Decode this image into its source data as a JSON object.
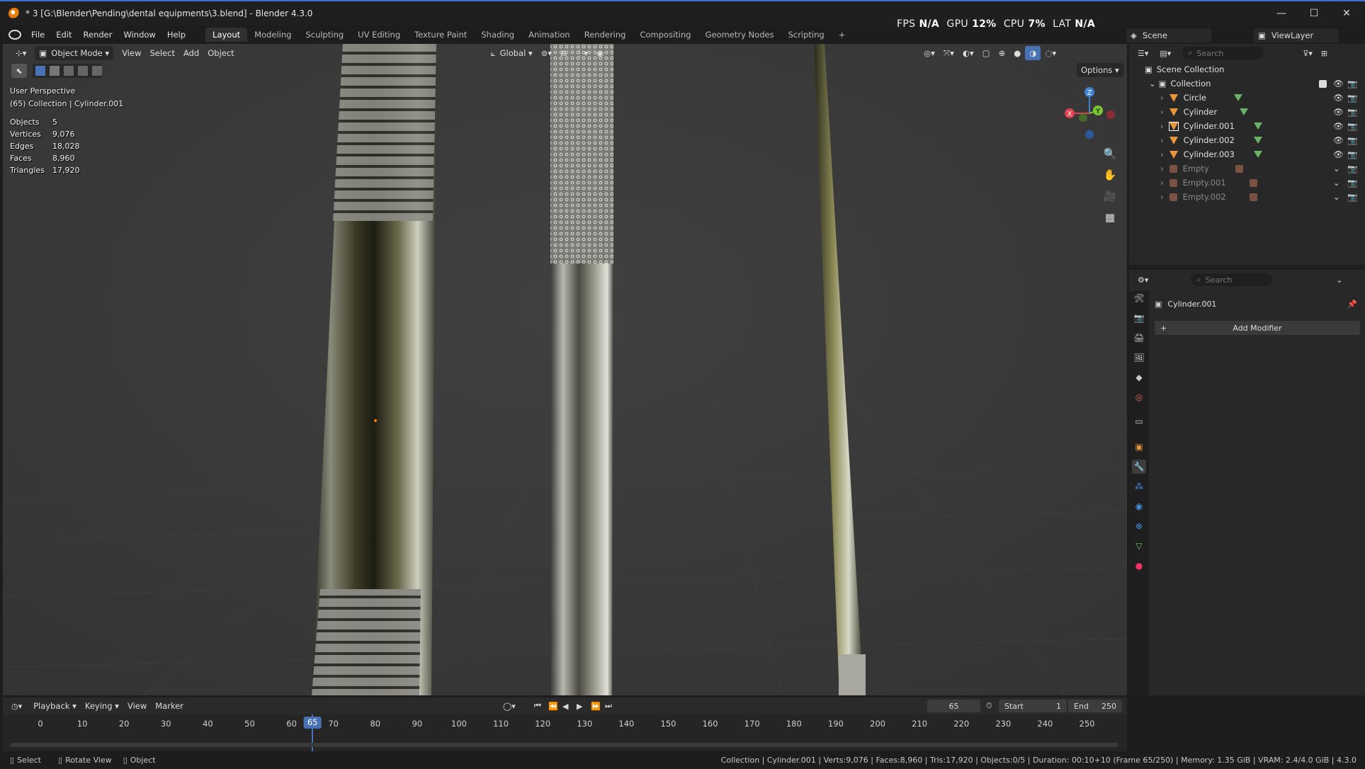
{
  "window": {
    "title": "* 3 [G:\\Blender\\Pending\\dental equipments\\3.blend] - Blender 4.3.0",
    "minimize_glyph": "—",
    "maximize_glyph": "☐",
    "close_glyph": "✕"
  },
  "menu": [
    "File",
    "Edit",
    "Render",
    "Window",
    "Help"
  ],
  "workspaces": [
    "Layout",
    "Modeling",
    "Sculpting",
    "UV Editing",
    "Texture Paint",
    "Shading",
    "Animation",
    "Rendering",
    "Compositing",
    "Geometry Nodes",
    "Scripting"
  ],
  "active_workspace": "Layout",
  "add_workspace_glyph": "+",
  "perf": {
    "fps_label": "FPS",
    "fps_value": "N/A",
    "gpu_label": "GPU",
    "gpu_value": "12%",
    "cpu_label": "CPU",
    "cpu_value": "7%",
    "lat_label": "LAT",
    "lat_value": "N/A"
  },
  "scene_field": "Scene",
  "viewlayer_field": "ViewLayer",
  "viewport_header": {
    "mode": "Object Mode",
    "menus": [
      "View",
      "Select",
      "Add",
      "Object"
    ],
    "transform_orientation": "Global",
    "options_label": "Options"
  },
  "viewport_overlay": {
    "perspective": "User Perspective",
    "context": "(65) Collection | Cylinder.001",
    "stats": [
      {
        "label": "Objects",
        "value": "5"
      },
      {
        "label": "Vertices",
        "value": "9,076"
      },
      {
        "label": "Edges",
        "value": "18,028"
      },
      {
        "label": "Faces",
        "value": "8,960"
      },
      {
        "label": "Triangles",
        "value": "17,920"
      }
    ]
  },
  "gizmo": {
    "x": "X",
    "y": "Y",
    "z": "Z"
  },
  "outliner": {
    "search_placeholder": "Search",
    "scene_collection": "Scene Collection",
    "collection": "Collection",
    "items": [
      {
        "name": "Circle",
        "type": "mesh",
        "dim": false
      },
      {
        "name": "Cylinder",
        "type": "mesh",
        "dim": false
      },
      {
        "name": "Cylinder.001",
        "type": "mesh",
        "dim": false,
        "selected": true
      },
      {
        "name": "Cylinder.002",
        "type": "mesh",
        "dim": false
      },
      {
        "name": "Cylinder.003",
        "type": "mesh",
        "dim": false
      },
      {
        "name": "Empty",
        "type": "empty",
        "dim": true
      },
      {
        "name": "Empty.001",
        "type": "empty",
        "dim": true
      },
      {
        "name": "Empty.002",
        "type": "empty",
        "dim": true
      }
    ]
  },
  "properties": {
    "search_placeholder": "Search",
    "object_name": "Cylinder.001",
    "add_modifier": "Add Modifier"
  },
  "timeline": {
    "menus": [
      "Playback",
      "Keying",
      "View",
      "Marker"
    ],
    "current_frame": "65",
    "start_label": "Start",
    "start_value": "1",
    "end_label": "End",
    "end_value": "250",
    "ticks": [
      "0",
      "10",
      "20",
      "30",
      "40",
      "50",
      "60",
      "70",
      "80",
      "90",
      "100",
      "110",
      "120",
      "130",
      "140",
      "150",
      "160",
      "170",
      "180",
      "190",
      "200",
      "210",
      "220",
      "230",
      "240",
      "250"
    ]
  },
  "statusbar": {
    "select": "Select",
    "rotate": "Rotate View",
    "object": "Object",
    "info": "Collection | Cylinder.001 | Verts:9,076 | Faces:8,960 | Tris:17,920 | Objects:0/5 | Duration: 00:10+10 (Frame 65/250) | Memory: 1.35 GiB | VRAM: 2.4/4.0 GiB | 4.3.0"
  },
  "colors": {
    "accent_blue": "#4772b3",
    "mesh_orange": "#e8963b",
    "gizmo_x": "#e2414e",
    "gizmo_y": "#7bc432",
    "gizmo_z": "#3f83d6"
  }
}
